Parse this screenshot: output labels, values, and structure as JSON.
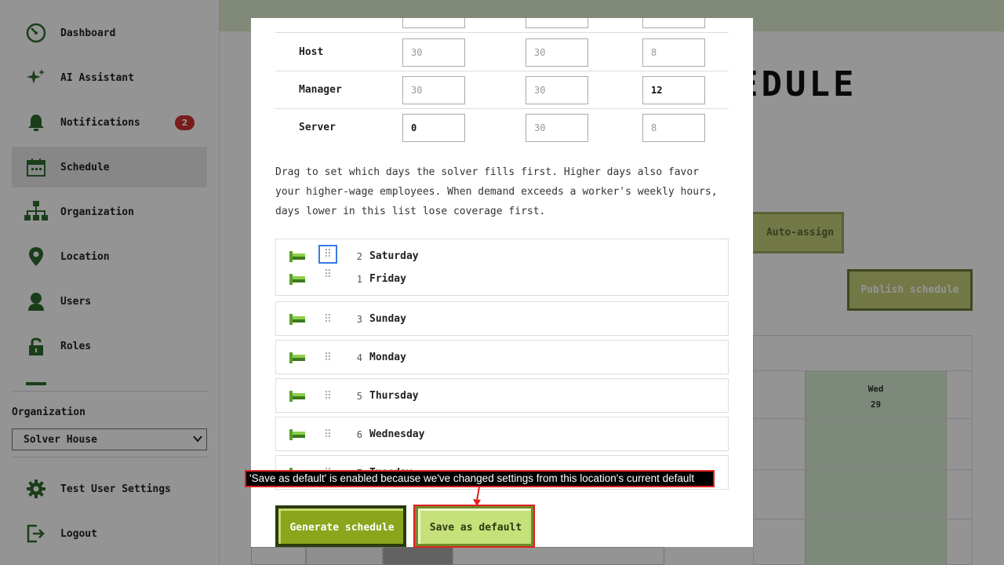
{
  "sidebar": {
    "items": [
      {
        "label": "Dashboard",
        "icon": "dashboard-icon"
      },
      {
        "label": "AI Assistant",
        "icon": "sparkle-icon"
      },
      {
        "label": "Notifications",
        "icon": "bell-icon",
        "badge": "2"
      },
      {
        "label": "Schedule",
        "icon": "calendar-icon",
        "active": true
      },
      {
        "label": "Organization",
        "icon": "org-chart-icon"
      },
      {
        "label": "Location",
        "icon": "location-pin-icon"
      },
      {
        "label": "Users",
        "icon": "user-icon"
      },
      {
        "label": "Roles",
        "icon": "lock-icon"
      }
    ],
    "organization_label": "Organization",
    "organization_selected": "Solver House",
    "footer": [
      {
        "label": "Test User Settings",
        "icon": "gear-icon"
      },
      {
        "label": "Logout",
        "icon": "logout-icon"
      }
    ]
  },
  "background": {
    "title_fragment": "EDULE",
    "auto_assign_label": "Auto-assign",
    "publish_label": "Publish schedule",
    "wed_day": "Wed",
    "wed_date": "29"
  },
  "modal": {
    "roles": [
      {
        "name": "Host",
        "min_hours": "30",
        "max_hours": "30",
        "shift": "8",
        "filled": [
          false,
          false,
          false
        ]
      },
      {
        "name": "Manager",
        "min_hours": "30",
        "max_hours": "30",
        "shift": "12",
        "filled": [
          false,
          false,
          true
        ]
      },
      {
        "name": "Server",
        "min_hours": "0",
        "max_hours": "30",
        "shift": "8",
        "filled": [
          true,
          false,
          false
        ]
      }
    ],
    "description": "Drag to set which days the solver fills first. Higher days also favor your higher-wage employees. When demand exceeds a worker's weekly hours, days lower in this list lose coverage first.",
    "days": [
      {
        "num": "2",
        "name": "Saturday"
      },
      {
        "num": "1",
        "name": "Friday"
      },
      {
        "num": "3",
        "name": "Sunday"
      },
      {
        "num": "4",
        "name": "Monday"
      },
      {
        "num": "5",
        "name": "Thursday"
      },
      {
        "num": "6",
        "name": "Wednesday"
      },
      {
        "num": "7",
        "name": "Tuesday"
      }
    ],
    "generate_label": "Generate schedule",
    "save_default_label": "Save as default"
  },
  "annotation": {
    "text": "'Save as default' is enabled because we've changed settings from this location's current default"
  },
  "colors": {
    "accent_green": "#8ba51c",
    "light_green": "#c6e07a",
    "badge_red": "#d0312d",
    "annotation_red": "#e02020"
  }
}
